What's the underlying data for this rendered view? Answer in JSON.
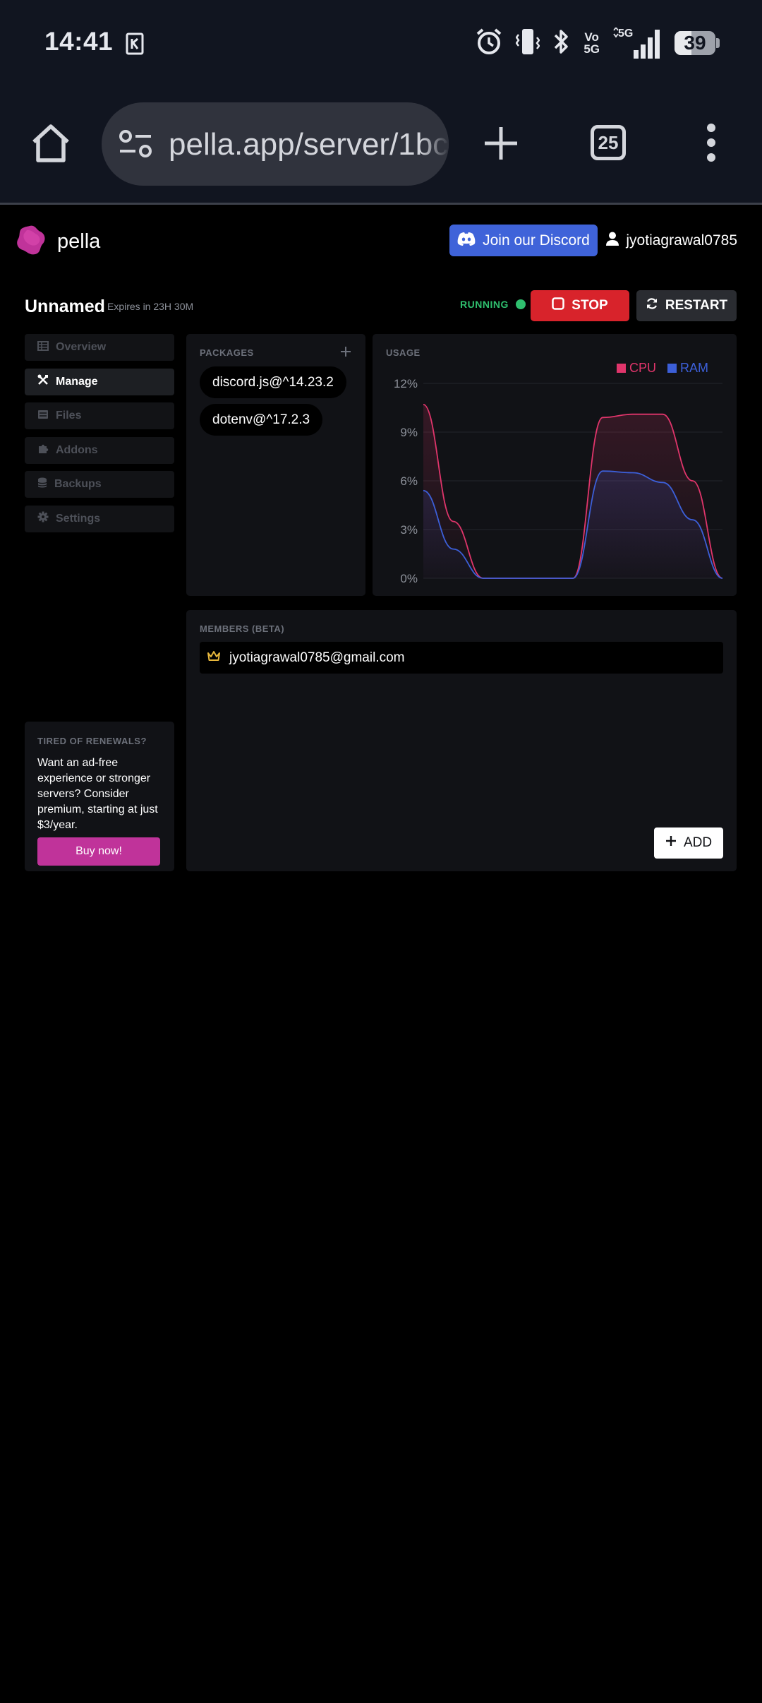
{
  "status_bar": {
    "time": "14:41",
    "volte_label": "Vo\n5G",
    "network": "5G",
    "battery": "39",
    "icons": [
      "notification-icon",
      "alarm-icon",
      "vibrate-icon",
      "bluetooth-icon",
      "signal-icon",
      "battery-icon"
    ]
  },
  "browser": {
    "url": "pella.app/server/1bc",
    "tab_count": "25",
    "icons": [
      "home-icon",
      "site-settings-icon",
      "new-tab-icon",
      "tabs-icon",
      "menu-icon"
    ]
  },
  "header": {
    "brand": "pella",
    "discord_button": "Join our Discord",
    "username": "jyotiagrawal0785"
  },
  "server": {
    "name": "Unnamed",
    "expires": "Expires in 23H 30M",
    "status": "RUNNING",
    "stop_label": "STOP",
    "restart_label": "RESTART"
  },
  "nav": {
    "items": [
      {
        "label": "Overview",
        "icon": "table-icon",
        "active": false
      },
      {
        "label": "Manage",
        "icon": "tools-icon",
        "active": true
      },
      {
        "label": "Files",
        "icon": "file-icon",
        "active": false
      },
      {
        "label": "Addons",
        "icon": "puzzle-icon",
        "active": false
      },
      {
        "label": "Backups",
        "icon": "database-icon",
        "active": false
      },
      {
        "label": "Settings",
        "icon": "gear-icon",
        "active": false
      }
    ]
  },
  "packages": {
    "title": "PACKAGES",
    "items": [
      "discord.js@^14.23.2",
      "dotenv@^17.2.3"
    ]
  },
  "usage": {
    "title": "USAGE"
  },
  "chart_data": {
    "type": "area",
    "title": "",
    "xlabel": "",
    "ylabel": "",
    "ylim": [
      0,
      12
    ],
    "y_ticks": [
      "0%",
      "3%",
      "6%",
      "9%",
      "12%"
    ],
    "legend_position": "top-right",
    "grid": true,
    "x": [
      0,
      1,
      2,
      3,
      4,
      5,
      6,
      7,
      8,
      9,
      10
    ],
    "series": [
      {
        "name": "CPU",
        "color": "#e0356b",
        "values": [
          10.7,
          3.5,
          0,
          0,
          0,
          0,
          9.9,
          10.1,
          10.1,
          6.0,
          0
        ]
      },
      {
        "name": "RAM",
        "color": "#3c5fd8",
        "values": [
          5.4,
          1.8,
          0,
          0,
          0,
          0,
          6.6,
          6.5,
          5.9,
          3.6,
          0
        ]
      }
    ]
  },
  "members": {
    "title": "MEMBERS (BETA)",
    "items": [
      {
        "email": "jyotiagrawal0785@gmail.com",
        "role": "owner"
      }
    ],
    "add_label": "ADD"
  },
  "promo": {
    "title": "TIRED OF RENEWALS?",
    "body": "Want an ad-free experience or stronger servers? Consider premium, starting at just $3/year.",
    "button": "Buy now!"
  },
  "colors": {
    "accent_discord": "#3f63d9",
    "stop": "#d8232b",
    "running": "#2fbf6e",
    "brand": "#c0339a"
  }
}
